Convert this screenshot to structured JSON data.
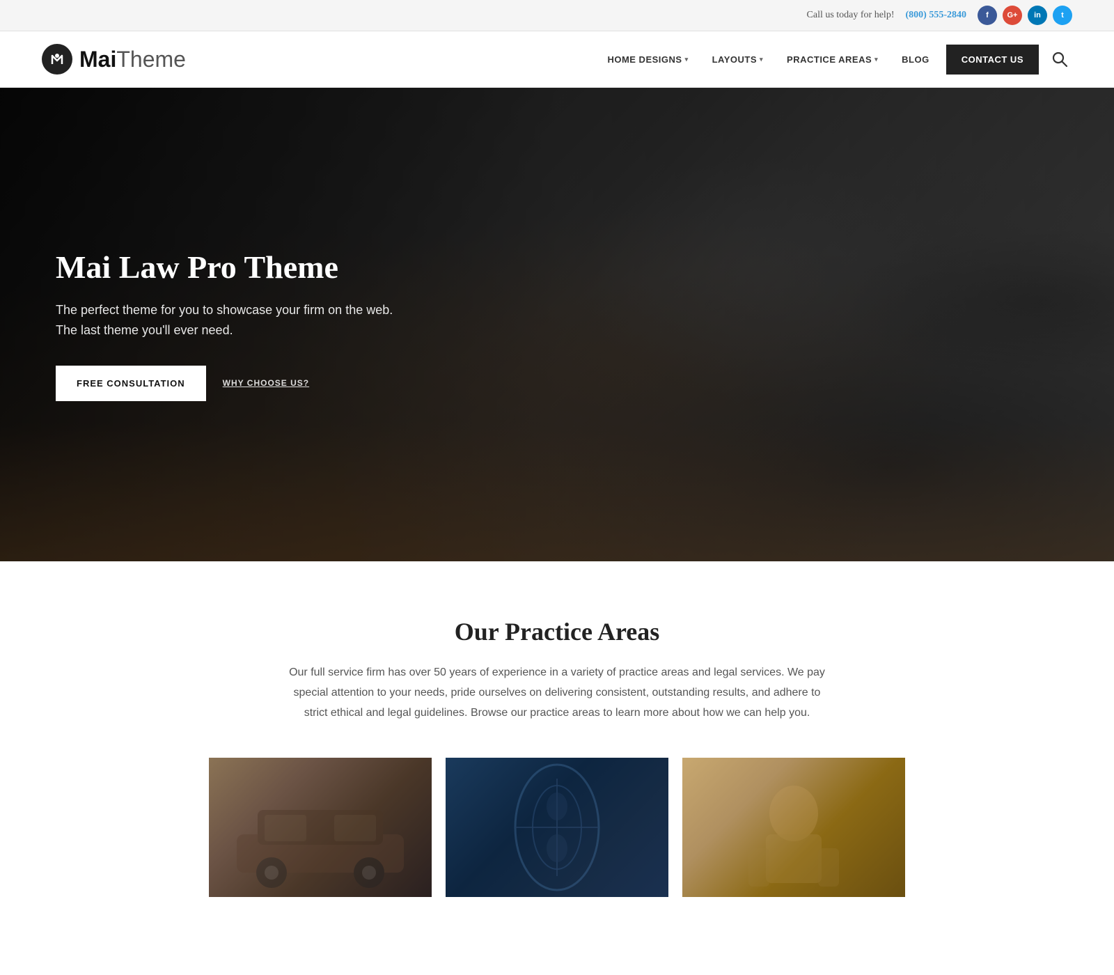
{
  "topbar": {
    "call_text": "Call us today for help!",
    "phone": "(800) 555-2840",
    "social": [
      {
        "name": "Facebook",
        "abbr": "f",
        "type": "fb"
      },
      {
        "name": "Google+",
        "abbr": "G+",
        "type": "gp"
      },
      {
        "name": "LinkedIn",
        "abbr": "in",
        "type": "li"
      },
      {
        "name": "Twitter",
        "abbr": "t",
        "type": "tw"
      }
    ]
  },
  "header": {
    "logo_mai": "Mai",
    "logo_theme": "Theme",
    "logo_icon_letter": "M",
    "nav": [
      {
        "label": "HOME DESIGNS",
        "has_dropdown": true
      },
      {
        "label": "LAYOUTS",
        "has_dropdown": true
      },
      {
        "label": "PRACTICE AREAS",
        "has_dropdown": true
      },
      {
        "label": "BLOG",
        "has_dropdown": false
      }
    ],
    "contact_btn": "CONTACT US",
    "search_icon": "🔍"
  },
  "hero": {
    "title": "Mai Law Pro Theme",
    "subtitle_line1": "The perfect theme for you to showcase your firm on the web.",
    "subtitle_line2": "The last theme you'll ever need.",
    "btn_primary": "FREE CONSULTATION",
    "btn_secondary": "WHY CHOOSE US?"
  },
  "practice": {
    "section_title": "Our Practice Areas",
    "section_desc": "Our full service firm has over 50 years of experience in a variety of practice areas and legal services. We pay special attention to your needs, pride ourselves on delivering consistent, outstanding results, and adhere to strict ethical and legal guidelines. Browse our practice areas to learn more about how we can help you.",
    "cards": [
      {
        "id": 1,
        "alt": "Car accident law"
      },
      {
        "id": 2,
        "alt": "Medical / X-ray law"
      },
      {
        "id": 3,
        "alt": "Personal injury law"
      }
    ]
  }
}
